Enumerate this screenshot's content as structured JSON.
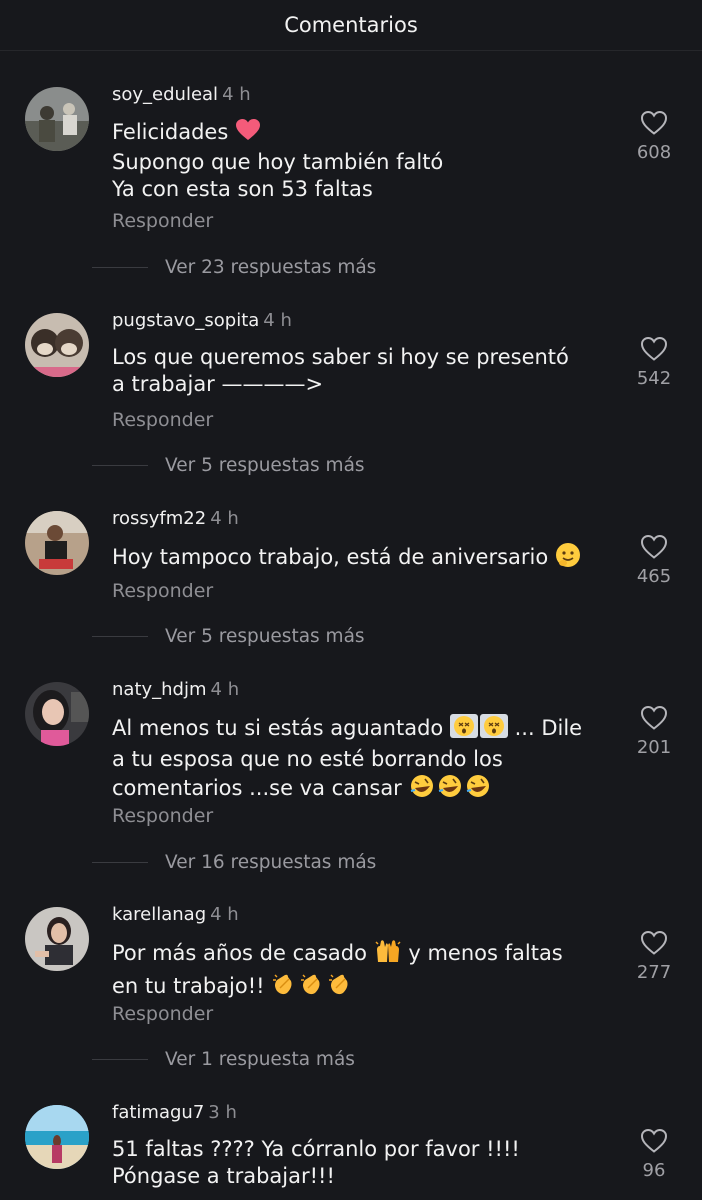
{
  "header": {
    "title": "Comentarios"
  },
  "reply_label": "Responder",
  "comments": [
    {
      "user": "soy_eduleal",
      "time": "4 h",
      "lines": [
        "Felicidades",
        "Supongo que hoy también faltó",
        "Ya con esta son 53 faltas"
      ],
      "likes": "608",
      "more": "Ver 23 respuestas más"
    },
    {
      "user": "pugstavo_sopita",
      "time": "4 h",
      "lines": [
        "Los que queremos saber si hoy se presentó",
        "a trabajar ————>"
      ],
      "likes": "542",
      "more": "Ver 5 respuestas más"
    },
    {
      "user": "rossyfm22",
      "time": "4 h",
      "lines": [
        "Hoy tampoco trabajo, está de aniversario"
      ],
      "likes": "465",
      "more": "Ver 5 respuestas más"
    },
    {
      "user": "naty_hdjm",
      "time": "4 h",
      "lines": [
        "Al menos tu si estás aguantado",
        "... Dile",
        "a tu esposa que no esté borrando los",
        "comentarios ...se va cansar"
      ],
      "likes": "201",
      "more": "Ver 16 respuestas más"
    },
    {
      "user": "karellanag",
      "time": "4 h",
      "lines": [
        "Por más años de casado",
        "y menos faltas",
        "en tu trabajo!!"
      ],
      "likes": "277",
      "more": "Ver 1 respuesta más"
    },
    {
      "user": "fatimagu7",
      "time": "3 h",
      "lines": [
        "51 faltas ???? Ya córranlo por favor !!!!",
        "Póngase a trabajar!!!"
      ],
      "likes": "96"
    }
  ],
  "emojis": [
    "red-heart",
    "slightly-smiling-face",
    "dizzy-face",
    "rolling-on-floor-laughing",
    "raising-hands",
    "clapping-hands"
  ]
}
